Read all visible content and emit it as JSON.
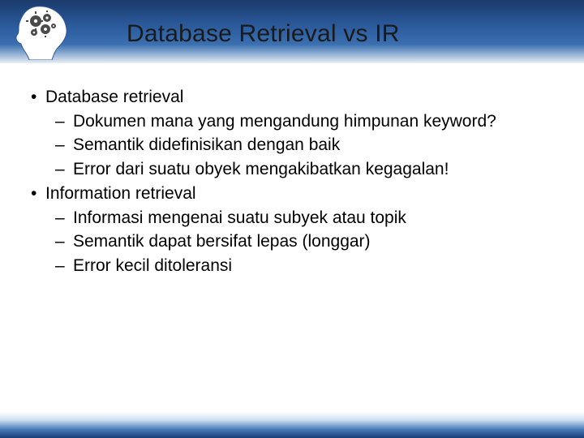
{
  "header": {
    "title": "Database Retrieval vs IR",
    "logo_alt": "head-gears-icon"
  },
  "bullets": [
    {
      "level": 1,
      "text": "Database retrieval"
    },
    {
      "level": 2,
      "text": "Dokumen mana yang mengandung himpunan keyword?"
    },
    {
      "level": 2,
      "text": "Semantik didefinisikan dengan baik"
    },
    {
      "level": 2,
      "text": "Error dari suatu obyek mengakibatkan kegagalan!"
    },
    {
      "level": 1,
      "text": "Information retrieval"
    },
    {
      "level": 2,
      "text": "Informasi mengenai suatu subyek atau topik"
    },
    {
      "level": 2,
      "text": "Semantik dapat bersifat lepas (longgar)"
    },
    {
      "level": 2,
      "text": "Error kecil ditoleransi"
    }
  ],
  "markers": {
    "l1": "•",
    "l2": "–"
  }
}
